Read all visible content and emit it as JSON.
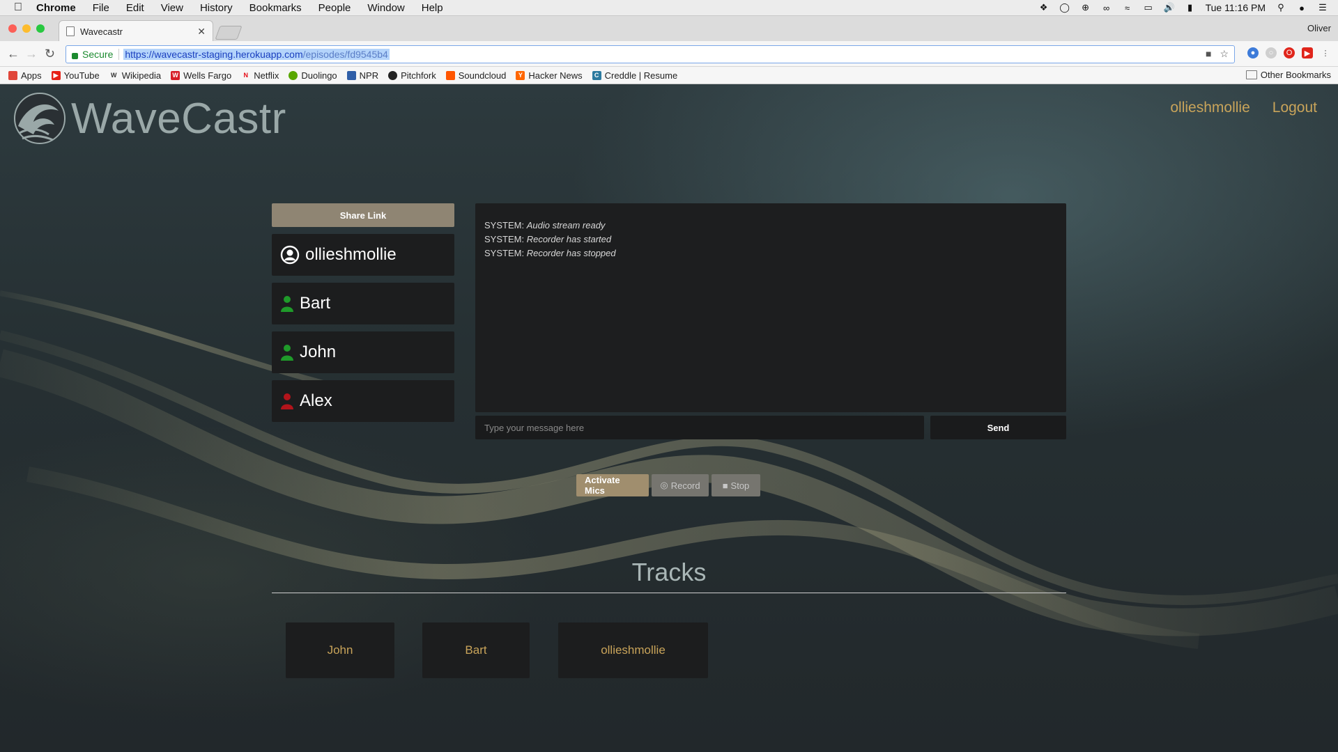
{
  "os_menubar": {
    "app_name": "Chrome",
    "menus": [
      "File",
      "Edit",
      "View",
      "History",
      "Bookmarks",
      "People",
      "Window",
      "Help"
    ],
    "clock": "Tue 11:16 PM"
  },
  "browser": {
    "tab_title": "Wavecastr",
    "profile_name": "Oliver",
    "secure_label": "Secure",
    "url_host": "https://wavecastr-staging.herokuapp.com",
    "url_path": "/episodes/fd9545b4",
    "bookmarks": [
      {
        "label": "Apps",
        "color": "#e0463a"
      },
      {
        "label": "YouTube",
        "color": "#e62117"
      },
      {
        "label": "Wikipedia",
        "color": "#333333"
      },
      {
        "label": "Wells Fargo",
        "color": "#d71e28"
      },
      {
        "label": "Netflix",
        "color": "#e50914"
      },
      {
        "label": "Duolingo",
        "color": "#58a700"
      },
      {
        "label": "NPR",
        "color": "#2f5fa8"
      },
      {
        "label": "Pitchfork",
        "color": "#222222"
      },
      {
        "label": "Soundcloud",
        "color": "#ff5500"
      },
      {
        "label": "Hacker News",
        "color": "#ff6600"
      },
      {
        "label": "Creddle | Resume",
        "color": "#2c7a9f"
      }
    ],
    "other_bookmarks": "Other Bookmarks"
  },
  "app": {
    "brand": "WaveCastr",
    "nav": {
      "username": "ollieshmollie",
      "logout": "Logout"
    },
    "share_link": "Share Link",
    "users": [
      {
        "name": "ollieshmollie",
        "status": "self"
      },
      {
        "name": "Bart",
        "status": "active",
        "icon_color": "#1f9a2a"
      },
      {
        "name": "John",
        "status": "active",
        "icon_color": "#1f9a2a"
      },
      {
        "name": "Alex",
        "status": "inactive",
        "icon_color": "#b3141b"
      }
    ],
    "chat": {
      "messages": [
        {
          "sender": "SYSTEM:",
          "text": "Audio stream ready"
        },
        {
          "sender": "SYSTEM:",
          "text": "Recorder has started"
        },
        {
          "sender": "SYSTEM:",
          "text": "Recorder has stopped"
        }
      ],
      "input_placeholder": "Type your message here",
      "send_label": "Send"
    },
    "controls": {
      "activate": "Activate Mics",
      "record": "Record",
      "stop": "Stop"
    },
    "tracks_title": "Tracks",
    "tracks": [
      "John",
      "Bart",
      "ollieshmollie"
    ],
    "colors": {
      "accent": "#c9a45a",
      "button": "#a08e6e"
    }
  }
}
